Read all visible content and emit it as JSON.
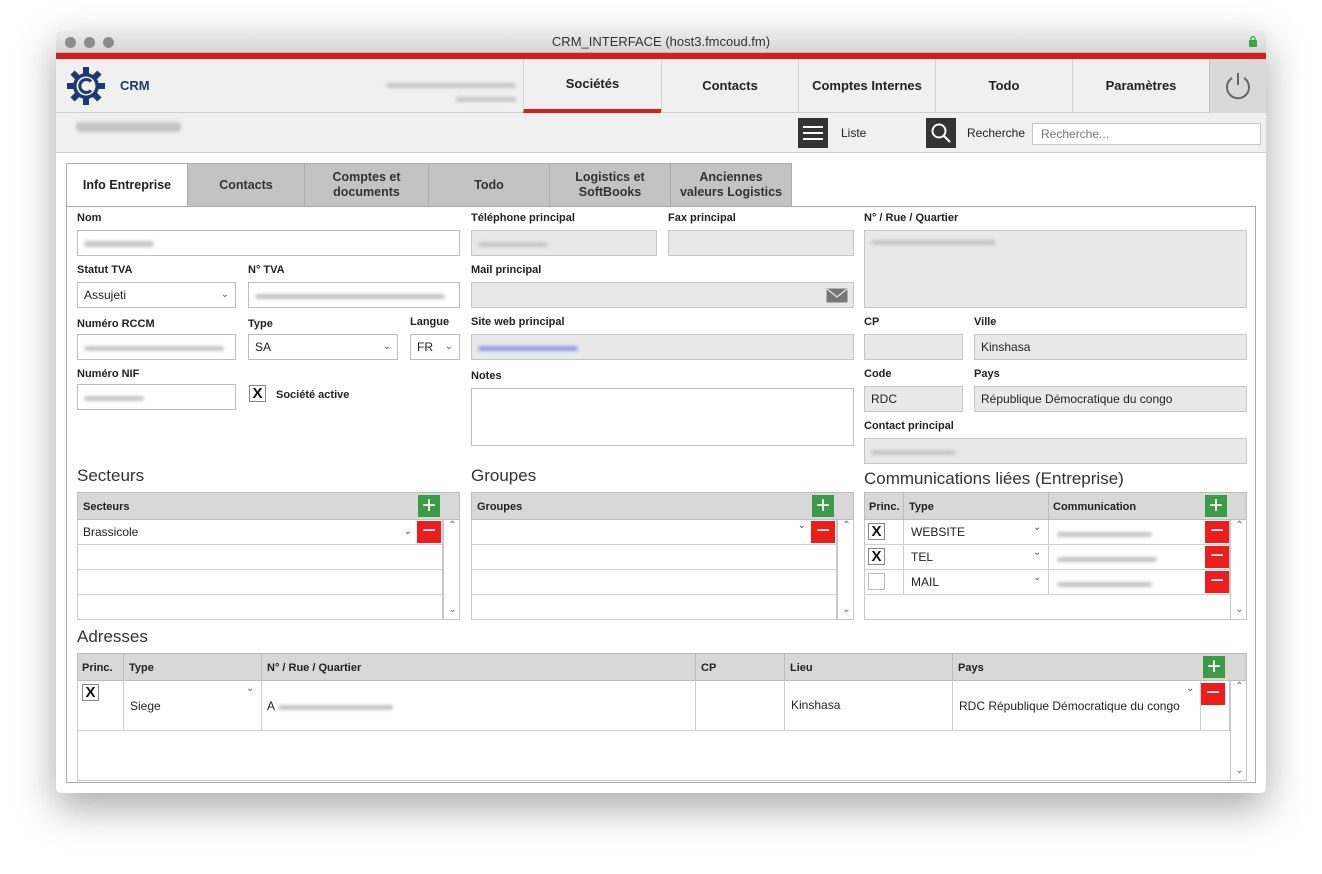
{
  "window": {
    "title": "CRM_INTERFACE (host3.fmcoud.fm)"
  },
  "app": {
    "brand": "CRM"
  },
  "nav": {
    "tabs": [
      "Sociétés",
      "Contacts",
      "Comptes Internes",
      "Todo",
      "Paramètres"
    ]
  },
  "toolbar": {
    "list_label": "Liste",
    "search_label": "Recherche",
    "search_placeholder": "Recherche..."
  },
  "form_tabs": [
    "Info Entreprise",
    "Contacts",
    "Comptes et documents",
    "Todo",
    "Logistics et SoftBooks",
    "Anciennes valeurs Logistics"
  ],
  "fields": {
    "nom": {
      "label": "Nom"
    },
    "statut_tva": {
      "label": "Statut TVA",
      "value": "Assujeti"
    },
    "num_tva": {
      "label": "N° TVA"
    },
    "num_rccm": {
      "label": "Numéro RCCM"
    },
    "type": {
      "label": "Type",
      "value": "SA"
    },
    "langue": {
      "label": "Langue",
      "value": "FR"
    },
    "num_nif": {
      "label": "Numéro NIF"
    },
    "societe_active": {
      "label": "Société active",
      "checked": "X"
    },
    "tel_principal": {
      "label": "Téléphone principal"
    },
    "fax_principal": {
      "label": "Fax principal"
    },
    "mail_principal": {
      "label": "Mail principal"
    },
    "site_web": {
      "label": "Site web principal"
    },
    "notes": {
      "label": "Notes"
    },
    "adresse": {
      "label": "N° / Rue / Quartier"
    },
    "cp": {
      "label": "CP"
    },
    "ville": {
      "label": "Ville",
      "value": "Kinshasa"
    },
    "code": {
      "label": "Code",
      "value": "RDC"
    },
    "pays": {
      "label": "Pays",
      "value": "République Démocratique du congo"
    },
    "contact_principal": {
      "label": "Contact principal"
    }
  },
  "secteurs": {
    "title": "Secteurs",
    "header": "Secteurs",
    "rows": [
      "Brassicole"
    ]
  },
  "groupes": {
    "title": "Groupes",
    "header": "Groupes"
  },
  "communications": {
    "title": "Communications liées (Entreprise)",
    "headers": [
      "Princ.",
      "Type",
      "Communication"
    ],
    "rows": [
      {
        "princ": "X",
        "type": "WEBSITE"
      },
      {
        "princ": "X",
        "type": "TEL"
      },
      {
        "princ": "",
        "type": "MAIL"
      }
    ]
  },
  "adresses": {
    "title": "Adresses",
    "headers": [
      "Princ.",
      "Type",
      "N° / Rue / Quartier",
      "CP",
      "Lieu",
      "Pays"
    ],
    "rows": [
      {
        "princ": "X",
        "type": "Siege",
        "rue_prefix": "A",
        "lieu": "Kinshasa",
        "pays": "RDC République Démocratique du congo"
      }
    ]
  },
  "icons": {
    "plus": "+",
    "minus": "−",
    "chevron": "⌄",
    "up": "⌃"
  },
  "colors": {
    "accent_red": "#d61e1e",
    "add_green": "#3d9a47",
    "remove_red": "#ee1d1d",
    "brand_blue": "#1c3b6e"
  }
}
